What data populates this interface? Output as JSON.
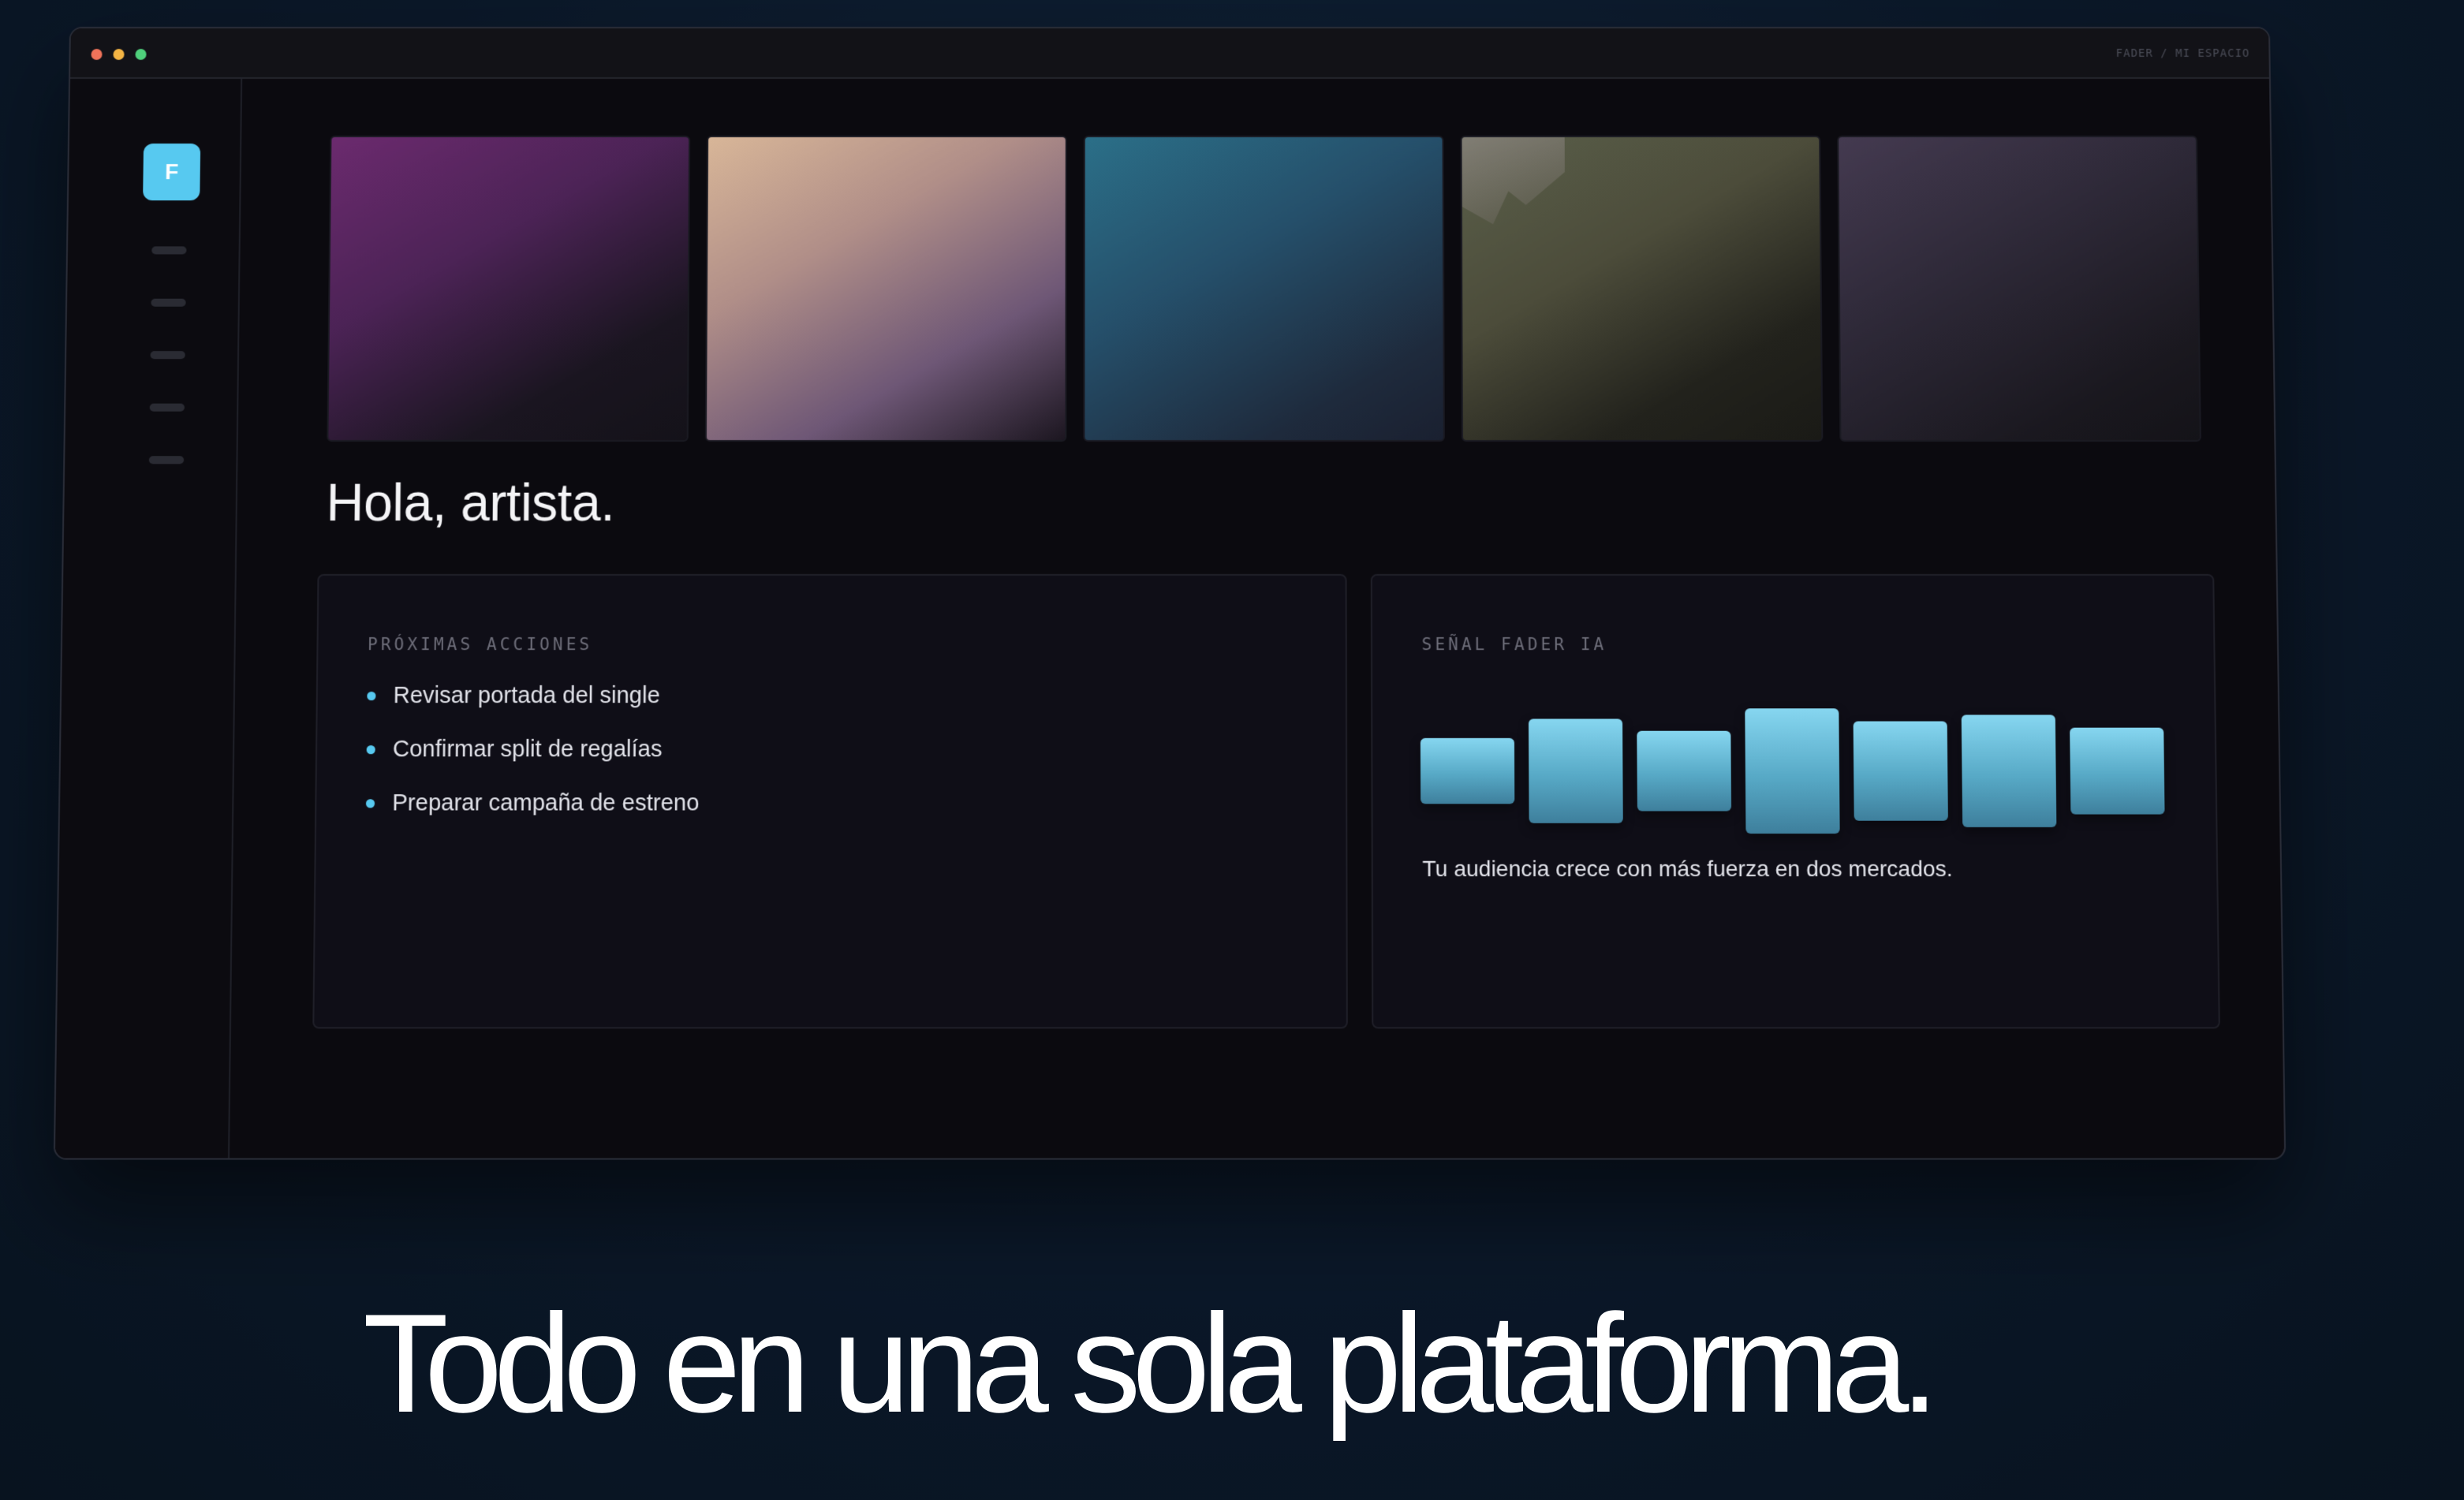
{
  "window": {
    "breadcrumb": "FADER / MI ESPACIO"
  },
  "sidebar": {
    "logo_letter": "F",
    "logo_color": "#57c9f0",
    "nav_icon": "menu-line-icon"
  },
  "main": {
    "greeting": "Hola, artista."
  },
  "actions_card": {
    "title": "PRÓXIMAS ACCIONES",
    "items": [
      "Revisar portada del single",
      "Confirmar split de regalías",
      "Preparar campaña de estreno"
    ]
  },
  "signal_card": {
    "title": "SEÑAL FADER IA",
    "bar_levels": [
      0.3,
      0.75,
      0.48,
      1.0,
      0.7,
      0.85,
      0.55
    ],
    "insight": "Tu audiencia crece con más fuerza en dos mercados."
  },
  "headline": "Todo en una sola plataforma.",
  "colors": {
    "accent": "#57c9f0",
    "background": "#0a1728",
    "panel": "#0f0e17"
  }
}
